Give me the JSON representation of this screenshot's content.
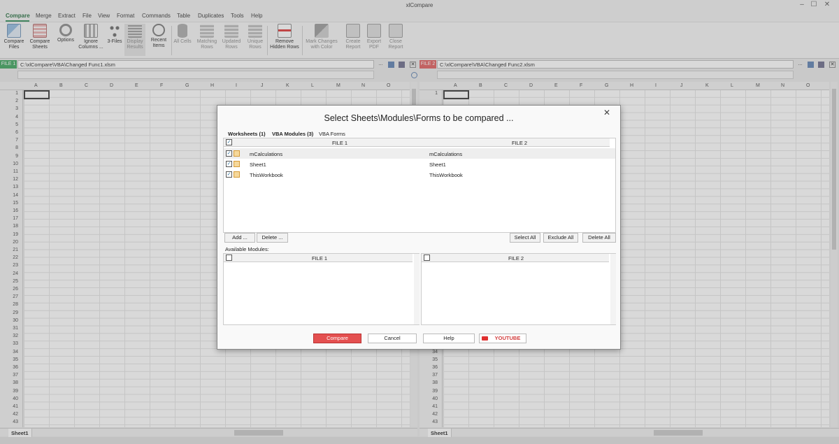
{
  "window": {
    "title": "xlCompare"
  },
  "menu": {
    "items": [
      "Compare",
      "Merge",
      "Extract",
      "File",
      "View",
      "Format",
      "Commands",
      "Table",
      "Duplicates",
      "Tools",
      "Help"
    ]
  },
  "ribbon": {
    "compare_files": [
      "Compare",
      "Files"
    ],
    "compare_sheets": [
      "Compare",
      "Sheets"
    ],
    "options": "Options",
    "ignore_columns": [
      "Ignore",
      "Columns ..."
    ],
    "three_files": "3-Files",
    "display_results": [
      "Display",
      "Results"
    ],
    "recent_items": [
      "Recent",
      "Items"
    ],
    "all_cells": "All Cells",
    "matching_rows": [
      "Matching",
      "Rows"
    ],
    "updated_rows": [
      "Updated",
      "Rows"
    ],
    "unique_rows": [
      "Unique",
      "Rows"
    ],
    "remove_hidden_rows": [
      "Remove",
      "Hidden Rows"
    ],
    "mark_changes": [
      "Mark Changes",
      "with Color"
    ],
    "create_report": [
      "Create",
      "Report"
    ],
    "export_pdf": [
      "Export",
      "PDF"
    ],
    "close_report": [
      "Close",
      "Report"
    ]
  },
  "file1": {
    "tag": "FILE 1",
    "path": "C:\\xlCompare\\VBA\\Changed Func1.xlsm",
    "sheet_tab": "Sheet1"
  },
  "file2": {
    "tag": "FILE 2",
    "path": "C:\\xlCompare\\VBA\\Changed Func2.xlsm",
    "sheet_tab": "Sheet1"
  },
  "grid": {
    "columns": [
      "A",
      "B",
      "C",
      "D",
      "E",
      "F",
      "G",
      "H",
      "I",
      "J",
      "K",
      "L",
      "M",
      "N",
      "O"
    ],
    "rows_left": [
      "1",
      "2",
      "3",
      "4",
      "5",
      "6",
      "7",
      "8",
      "9",
      "10",
      "11",
      "12",
      "13",
      "14",
      "15",
      "16",
      "17",
      "18",
      "19",
      "20",
      "21",
      "22",
      "23",
      "24",
      "25",
      "26",
      "27",
      "28",
      "29",
      "30",
      "31",
      "32",
      "33",
      "34",
      "35",
      "36",
      "37",
      "38",
      "39",
      "40",
      "41",
      "42",
      "43"
    ],
    "rows_right_bottom": [
      "34",
      "35",
      "36",
      "37",
      "38",
      "39",
      "40",
      "41",
      "42",
      "43"
    ],
    "rows_right_top": [
      "1"
    ]
  },
  "dialog": {
    "title": "Select Sheets\\Modules\\Forms to be compared ...",
    "tabs": [
      "Worksheets (1)",
      "VBA Modules (3)",
      "VBA Forms"
    ],
    "col_file1": "FILE 1",
    "col_file2": "FILE 2",
    "modules": [
      {
        "file1": "mCalculations",
        "file2": "mCalculations"
      },
      {
        "file1": "Sheet1",
        "file2": "Sheet1"
      },
      {
        "file1": "ThisWorkbook",
        "file2": "ThisWorkbook"
      }
    ],
    "add_label": "Add ...",
    "delete_label": "Delete ...",
    "select_all_label": "Select All",
    "exclude_all_label": "Exclude All",
    "delete_all_label": "Delete All",
    "available_label": "Available Modules:",
    "avail_file1": "FILE 1",
    "avail_file2": "FILE 2",
    "compare_label": "Compare",
    "cancel_label": "Cancel",
    "help_label": "Help",
    "youtube_label": "YOUTUBE"
  },
  "colors": {
    "file1_tag": "#3aa35b",
    "file2_tag": "#e05a5a",
    "accent": "#2e8b57",
    "compare_button": "#e45050"
  }
}
